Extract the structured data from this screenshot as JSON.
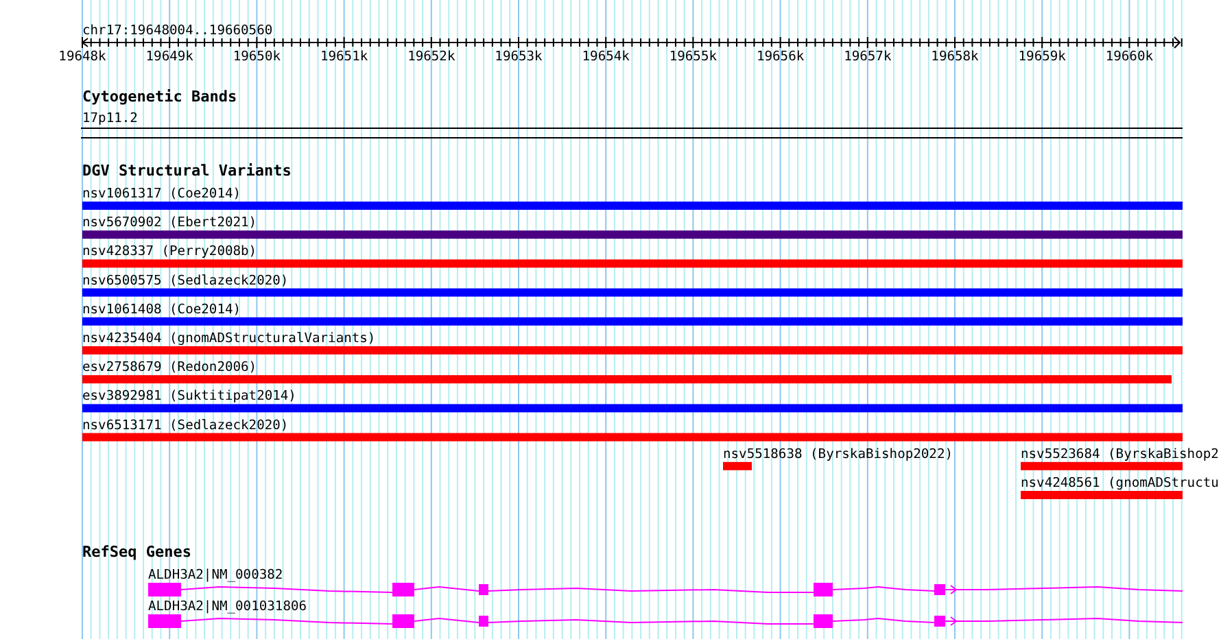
{
  "location": "chr17:19648004..19660560",
  "ruler": {
    "ticks": [
      "19648k",
      "19649k",
      "19650k",
      "19651k",
      "19652k",
      "19653k",
      "19654k",
      "19655k",
      "19656k",
      "19657k",
      "19658k",
      "19659k",
      "19660k"
    ]
  },
  "tracks": [
    {
      "kind": "bands",
      "title": "Cytogenetic Bands",
      "features": [
        {
          "label": "17p11.2"
        }
      ]
    },
    {
      "kind": "variants",
      "title": "DGV Structural Variants",
      "features": [
        {
          "label": "nsv1061317 (Coe2014)",
          "color": "#0000ff"
        },
        {
          "label": "nsv5670902 (Ebert2021)",
          "color": "#4b0082"
        },
        {
          "label": "nsv428337 (Perry2008b)",
          "color": "#ff0000"
        },
        {
          "label": "nsv6500575 (Sedlazeck2020)",
          "color": "#0000ff"
        },
        {
          "label": "nsv1061408 (Coe2014)",
          "color": "#0000ff"
        },
        {
          "label": "nsv4235404 (gnomADStructuralVariants)",
          "color": "#ff0000"
        },
        {
          "label": "esv2758679 (Redon2006)",
          "color": "#ff0000"
        },
        {
          "label": "esv3892981 (Suktitipat2014)",
          "color": "#0000ff"
        },
        {
          "label": "nsv6513171 (Sedlazeck2020)",
          "color": "#ff0000"
        },
        {
          "label": "nsv5518638 (ByrskaBishop2022)",
          "color": "#ff0000"
        },
        {
          "label": "nsv5523684 (ByrskaBishop2",
          "color": "#ff0000"
        },
        {
          "label": "nsv4248561 (gnomADStructu",
          "color": "#ff0000"
        }
      ]
    },
    {
      "kind": "genes",
      "title": "RefSeq Genes",
      "features": [
        {
          "label": "ALDH3A2|NM_000382"
        },
        {
          "label": "ALDH3A2|NM_001031806"
        }
      ]
    }
  ]
}
